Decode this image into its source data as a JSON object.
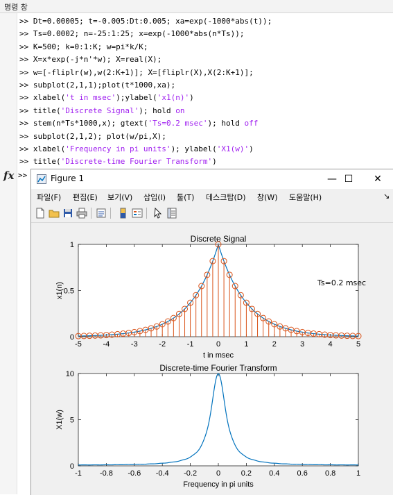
{
  "command_window": {
    "title": "명령 창",
    "prompt": ">>",
    "fx_symbol": "fx",
    "lines": [
      {
        "segments": [
          {
            "t": "Dt=0.00005; t=-0.005:Dt:0.005; xa=exp(-1000*abs(t));",
            "s": 0
          }
        ]
      },
      {
        "segments": [
          {
            "t": "Ts=0.0002; n=-25:1:25; x=exp(-1000*abs(n*Ts));",
            "s": 0
          }
        ]
      },
      {
        "segments": [
          {
            "t": "K=500; k=0:1:K; w=pi*k/K;",
            "s": 0
          }
        ]
      },
      {
        "segments": [
          {
            "t": "X=x*exp(-j*n'*w); X=real(X);",
            "s": 0
          }
        ]
      },
      {
        "segments": [
          {
            "t": "w=[-fliplr(w),w(2:K+1)]; X=[fliplr(X),X(2:K+1)];",
            "s": 0
          }
        ]
      },
      {
        "segments": [
          {
            "t": "subplot(2,1,1);plot(t*1000,xa);",
            "s": 0
          }
        ]
      },
      {
        "segments": [
          {
            "t": "xlabel(",
            "s": 0
          },
          {
            "t": "'t in msec'",
            "s": 1
          },
          {
            "t": ");ylabel(",
            "s": 0
          },
          {
            "t": "'x1(n)'",
            "s": 1
          },
          {
            "t": ")",
            "s": 0
          }
        ]
      },
      {
        "segments": [
          {
            "t": "title(",
            "s": 0
          },
          {
            "t": "'Discrete Signal'",
            "s": 1
          },
          {
            "t": "); hold ",
            "s": 0
          },
          {
            "t": "on",
            "s": 1
          }
        ]
      },
      {
        "segments": [
          {
            "t": "stem(n*Ts*1000,x); gtext(",
            "s": 0
          },
          {
            "t": "'Ts=0.2 msec'",
            "s": 1
          },
          {
            "t": "); hold ",
            "s": 0
          },
          {
            "t": "off",
            "s": 1
          }
        ]
      },
      {
        "segments": [
          {
            "t": "subplot(2,1,2); plot(w/pi,X);",
            "s": 0
          }
        ]
      },
      {
        "segments": [
          {
            "t": "xlabel(",
            "s": 0
          },
          {
            "t": "'Frequency in pi units'",
            "s": 1
          },
          {
            "t": "); ylabel(",
            "s": 0
          },
          {
            "t": "'X1(w)'",
            "s": 1
          },
          {
            "t": ")",
            "s": 0
          }
        ]
      },
      {
        "segments": [
          {
            "t": "title(",
            "s": 0
          },
          {
            "t": "'Discrete-time Fourier Transform'",
            "s": 1
          },
          {
            "t": ")",
            "s": 0
          }
        ]
      }
    ]
  },
  "figure": {
    "title": "Figure 1",
    "window_buttons": {
      "minimize": "—",
      "maximize": "☐",
      "close": "✕"
    },
    "menus": [
      "파일(F)",
      "편집(E)",
      "보기(V)",
      "삽입(I)",
      "툴(T)",
      "데스크탑(D)",
      "창(W)",
      "도움말(H)"
    ],
    "menu_overflow": "↘",
    "toolbar_icons": [
      "new-file-icon",
      "open-folder-icon",
      "save-icon",
      "print-icon",
      "print-preview-icon",
      "link-plot-icon",
      "insert-colorbar-icon",
      "insert-legend-icon",
      "pointer-icon",
      "property-inspector-icon"
    ]
  },
  "colors": {
    "stem": "#d95319",
    "line": "#0072bd",
    "string": "#a020f0"
  },
  "chart_data": [
    {
      "type": "line",
      "title": "Discrete Signal",
      "xlabel": "t in msec",
      "ylabel": "x1(n)",
      "xlim": [
        -5,
        5
      ],
      "ylim": [
        0,
        1
      ],
      "xticks": [
        "-5",
        "-4",
        "-3",
        "-2",
        "-1",
        "0",
        "1",
        "2",
        "3",
        "4",
        "5"
      ],
      "yticks": [
        "0",
        "0.5",
        "1"
      ],
      "annotation": "Ts=0.2 msec",
      "series": [
        {
          "kind": "line",
          "formula": "exp(-abs(t))",
          "x_start": -5,
          "x_end": 5,
          "x_step": 0.05
        },
        {
          "kind": "stem",
          "formula": "exp(-abs(t))",
          "x_start": -5,
          "x_end": 5,
          "x_step": 0.2
        }
      ]
    },
    {
      "type": "line",
      "title": "Discrete-time Fourier Transform",
      "xlabel": "Frequency in pi units",
      "ylabel": "X1(w)",
      "xlim": [
        -1,
        1
      ],
      "ylim": [
        0,
        10
      ],
      "xticks": [
        "-1",
        "-0.8",
        "-0.6",
        "-0.4",
        "-0.2",
        "0",
        "0.2",
        "0.4",
        "0.6",
        "0.8",
        "1"
      ],
      "yticks": [
        "0",
        "5",
        "10"
      ],
      "series": [
        {
          "kind": "line",
          "formula": "DTFT of exp(-0.2*abs(n)), n=-25..25",
          "x_start": -1,
          "x_end": 1,
          "x_step": 0.002
        }
      ]
    }
  ]
}
